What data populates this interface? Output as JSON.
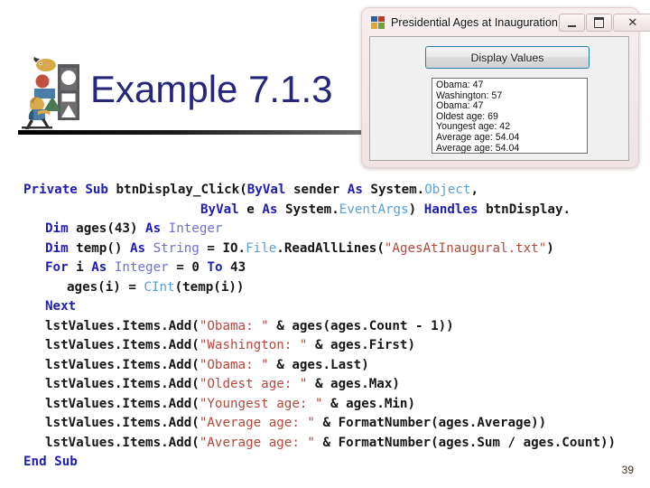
{
  "slide": {
    "title": "Example 7.1.3",
    "page_number": "39",
    "title_color": "#26267a",
    "clipart_name": "person-carrying-shapes-clipart"
  },
  "code": {
    "lines": [
      [
        {
          "t": "Private ",
          "c": "kw"
        },
        {
          "t": "Sub ",
          "c": "kw"
        },
        {
          "t": "btnDisplay_Click",
          "c": "plain"
        },
        {
          "t": "(",
          "c": "plain"
        },
        {
          "t": "ByVal ",
          "c": "kw"
        },
        {
          "t": "sender ",
          "c": "plain"
        },
        {
          "t": "As ",
          "c": "kw"
        },
        {
          "t": "System.",
          "c": "plain"
        },
        {
          "t": "Object",
          "c": "cls"
        },
        {
          "t": ",",
          "c": "plain"
        }
      ],
      [
        {
          "t": "ByVal ",
          "c": "kw"
        },
        {
          "t": "e ",
          "c": "plain"
        },
        {
          "t": "As ",
          "c": "kw"
        },
        {
          "t": "System.",
          "c": "plain"
        },
        {
          "t": "EventArgs",
          "c": "cls"
        },
        {
          "t": ") ",
          "c": "plain"
        },
        {
          "t": "Handles ",
          "c": "kw"
        },
        {
          "t": "btnDisplay.",
          "c": "plain"
        }
      ],
      [
        {
          "t": "Dim ",
          "c": "kw"
        },
        {
          "t": "ages(43) ",
          "c": "plain"
        },
        {
          "t": "As ",
          "c": "kw"
        },
        {
          "t": "Integer",
          "c": "typ"
        }
      ],
      [
        {
          "t": "Dim ",
          "c": "kw"
        },
        {
          "t": "temp() ",
          "c": "plain"
        },
        {
          "t": "As ",
          "c": "kw"
        },
        {
          "t": "String ",
          "c": "typ"
        },
        {
          "t": "= IO.",
          "c": "plain"
        },
        {
          "t": "File",
          "c": "cls"
        },
        {
          "t": ".ReadAllLines(",
          "c": "plain"
        },
        {
          "t": "\"AgesAtInaugural.txt\"",
          "c": "str"
        },
        {
          "t": ")",
          "c": "plain"
        }
      ],
      [
        {
          "t": "For ",
          "c": "kw"
        },
        {
          "t": "i ",
          "c": "plain"
        },
        {
          "t": "As ",
          "c": "kw"
        },
        {
          "t": "Integer ",
          "c": "typ"
        },
        {
          "t": "= 0 ",
          "c": "plain"
        },
        {
          "t": "To ",
          "c": "kw"
        },
        {
          "t": "43",
          "c": "plain"
        }
      ],
      [
        {
          "t": "ages(i) = ",
          "c": "plain"
        },
        {
          "t": "CInt",
          "c": "cls"
        },
        {
          "t": "(temp(i))",
          "c": "plain"
        }
      ],
      [
        {
          "t": "Next",
          "c": "kw"
        }
      ],
      [
        {
          "t": "lstValues.Items.Add(",
          "c": "plain"
        },
        {
          "t": "\"Obama: \"",
          "c": "str"
        },
        {
          "t": " & ages(ages.Count - 1))",
          "c": "plain"
        }
      ],
      [
        {
          "t": "lstValues.Items.Add(",
          "c": "plain"
        },
        {
          "t": "\"Washington: \"",
          "c": "str"
        },
        {
          "t": " & ages.First)",
          "c": "plain"
        }
      ],
      [
        {
          "t": "lstValues.Items.Add(",
          "c": "plain"
        },
        {
          "t": "\"Obama: \"",
          "c": "str"
        },
        {
          "t": " & ages.Last)",
          "c": "plain"
        }
      ],
      [
        {
          "t": "lstValues.Items.Add(",
          "c": "plain"
        },
        {
          "t": "\"Oldest age: \"",
          "c": "str"
        },
        {
          "t": " & ages.Max)",
          "c": "plain"
        }
      ],
      [
        {
          "t": "lstValues.Items.Add(",
          "c": "plain"
        },
        {
          "t": "\"Youngest age: \"",
          "c": "str"
        },
        {
          "t": " & ages.Min)",
          "c": "plain"
        }
      ],
      [
        {
          "t": "lstValues.Items.Add(",
          "c": "plain"
        },
        {
          "t": "\"Average age: \"",
          "c": "str"
        },
        {
          "t": " & FormatNumber(ages.Average))",
          "c": "plain"
        }
      ],
      [
        {
          "t": "lstValues.Items.Add(",
          "c": "plain"
        },
        {
          "t": "\"Average age: \"",
          "c": "str"
        },
        {
          "t": " & FormatNumber(ages.Sum / ages.Count))",
          "c": "plain"
        }
      ],
      [
        {
          "t": "End ",
          "c": "kw"
        },
        {
          "t": "Sub",
          "c": "kw"
        }
      ]
    ],
    "indents": [
      0,
      6,
      1,
      1,
      1,
      2,
      1,
      1,
      1,
      1,
      1,
      1,
      1,
      1,
      0
    ]
  },
  "winform": {
    "title": "Presidential Ages at Inauguration",
    "app_icon_name": "vb-form-icon",
    "titlebar_buttons": [
      {
        "name": "minimize-button",
        "glyph": "minimize"
      },
      {
        "name": "maximize-button",
        "glyph": "maximize"
      },
      {
        "name": "close-button",
        "glyph": "✕"
      }
    ],
    "display_button_label": "Display Values",
    "listbox_items": [
      "Obama: 47",
      "Washington: 57",
      "Obama: 47",
      "Oldest age: 69",
      "Youngest age: 42",
      "Average age: 54.04",
      "Average age: 54.04"
    ]
  }
}
